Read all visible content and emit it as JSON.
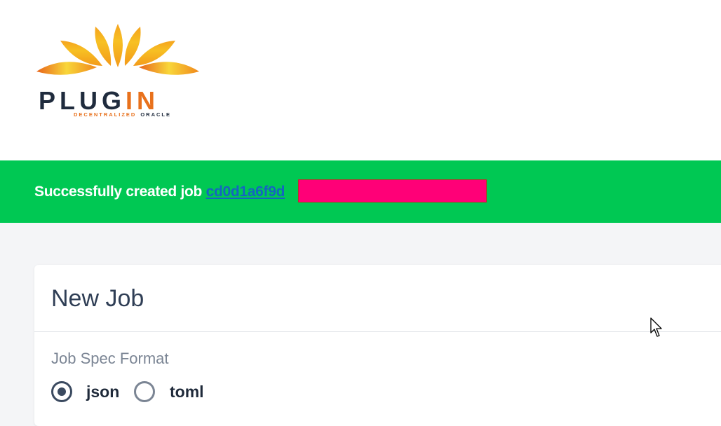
{
  "logo": {
    "word_dark": "PLUG",
    "word_accent": "IN",
    "tagline_accent": "DECENTRALIZED",
    "tagline_dark": "ORACLE",
    "colors": {
      "dark": "#1f2b3d",
      "accent": "#e8711c"
    }
  },
  "banner": {
    "message": "Successfully created job ",
    "job_id": "cd0d1a6f9d",
    "color": "#00c853"
  },
  "card": {
    "title": "New Job",
    "format_label": "Job Spec Format",
    "options": [
      {
        "label": "json",
        "selected": true
      },
      {
        "label": "toml",
        "selected": false
      }
    ]
  }
}
